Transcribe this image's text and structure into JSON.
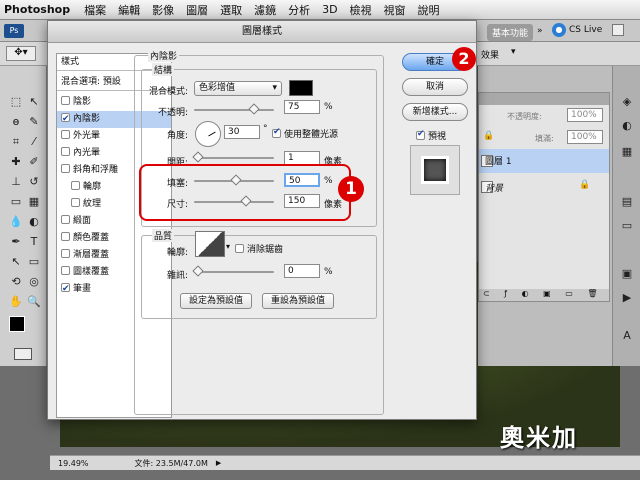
{
  "menubar": {
    "app": "Photoshop",
    "items": [
      "檔案",
      "編輯",
      "影像",
      "圖層",
      "選取",
      "濾鏡",
      "分析",
      "3D",
      "檢視",
      "視窗",
      "說明"
    ]
  },
  "appbar": {
    "workspace": "基本功能",
    "cslive": "CS Live"
  },
  "optbar": {
    "effect_text": "效果"
  },
  "dialog": {
    "title": "圖層樣式",
    "styles_header": "樣式",
    "blend_options": "混合選項: 預設",
    "items": [
      {
        "label": "陰影",
        "checked": false
      },
      {
        "label": "內陰影",
        "checked": true,
        "selected": true
      },
      {
        "label": "外光暈",
        "checked": false
      },
      {
        "label": "內光暈",
        "checked": false
      },
      {
        "label": "斜角和浮雕",
        "checked": false
      },
      {
        "label": "輪廓",
        "checked": false,
        "indent": true
      },
      {
        "label": "紋理",
        "checked": false,
        "indent": true
      },
      {
        "label": "緞面",
        "checked": false
      },
      {
        "label": "顏色覆蓋",
        "checked": false
      },
      {
        "label": "漸層覆蓋",
        "checked": false
      },
      {
        "label": "圖樣覆蓋",
        "checked": false
      },
      {
        "label": "筆畫",
        "checked": true
      }
    ],
    "inner_shadow": {
      "group_title": "內陰影",
      "structure_title": "結構",
      "blend_mode_label": "混合模式:",
      "blend_mode_value": "色彩增值",
      "opacity_label": "不透明:",
      "opacity_value": "75",
      "opacity_unit": "%",
      "angle_label": "角度:",
      "angle_value": "30",
      "angle_unit": "°",
      "global_light_label": "使用整體光源",
      "distance_label": "間距:",
      "distance_value": "1",
      "distance_unit": "像素",
      "choke_label": "填塞:",
      "choke_value": "50",
      "choke_unit": "%",
      "size_label": "尺寸:",
      "size_value": "150",
      "size_unit": "像素",
      "quality_title": "品質",
      "contour_label": "輪廓:",
      "antialias_label": "消除鋸齒",
      "noise_label": "雜訊:",
      "noise_value": "0",
      "noise_unit": "%",
      "set_default": "設定為預設值",
      "reset_default": "重設為預設值"
    },
    "buttons": {
      "ok": "確定",
      "cancel": "取消",
      "new_style": "新增樣式...",
      "preview": "預視"
    }
  },
  "layers": {
    "opacity_label": "不透明度:",
    "opacity_value": "100%",
    "fill_label": "填滿:",
    "fill_value": "100%",
    "rows": [
      {
        "name": "圖層 1",
        "selected": true
      },
      {
        "name": "背景",
        "selected": false
      }
    ]
  },
  "status": {
    "zoom": "19.49%",
    "file": "文件: 23.5M/47.0M"
  },
  "callouts": [
    "1",
    "2"
  ],
  "watermark": "奧米加",
  "colors": {
    "callout_red": "#dd0000",
    "selection_blue": "#b9d1f2",
    "ok_blue": "#6aa6ee"
  }
}
